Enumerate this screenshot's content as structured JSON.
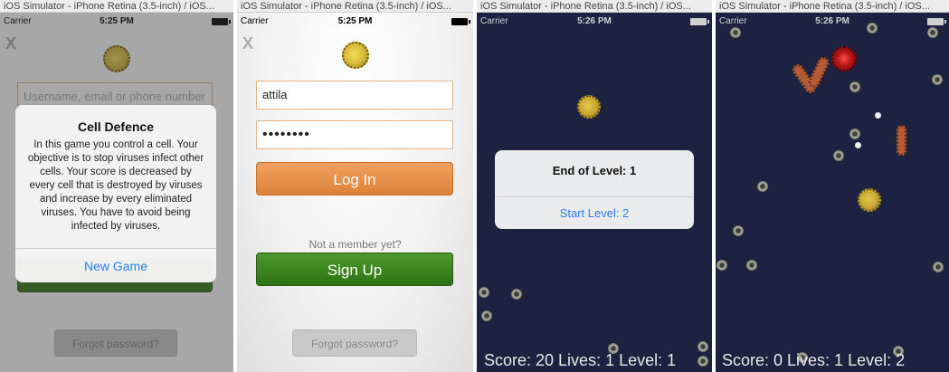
{
  "simulator_title": "iOS Simulator - iPhone Retina (3.5-inch) / iOS...",
  "status": {
    "carrier": "Carrier",
    "time_1": "5:25 PM",
    "time_2": "5:26 PM"
  },
  "screen1": {
    "close_label": "X",
    "username_placeholder": "Username, email or phone number",
    "alert_title": "Cell Defence",
    "alert_message": "In this game you control a cell. Your objective is to stop viruses infect other cells. Your score is decreased by every cell that is destroyed by viruses and increase by every eliminated viruses. You have to avoid being infected by viruses.",
    "alert_button": "New Game",
    "forgot_label": "Forgot password?"
  },
  "screen2": {
    "close_label": "X",
    "username_value": "attila",
    "password_value": "••••••••",
    "login_label": "Log In",
    "not_member": "Not a member yet?",
    "signup_label": "Sign Up",
    "forgot_label": "Forgot password?"
  },
  "screen3": {
    "alert_title": "End of Level: 1",
    "alert_button": "Start Level: 2",
    "hud": "Score: 20 Lives: 1 Level: 1"
  },
  "screen4": {
    "hud": "Score: 0 Lives: 1 Level: 2"
  },
  "colors": {
    "accent_blue": "#2a7ef4",
    "login_orange": "#e48a43",
    "signup_green": "#3a8420",
    "game_bg": "#1c2240"
  }
}
